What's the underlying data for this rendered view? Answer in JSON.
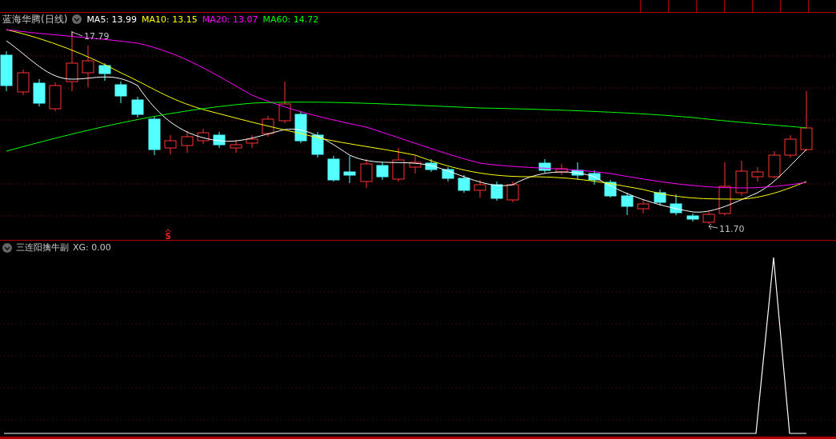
{
  "stock": {
    "name": "蓝海华腾",
    "period": "(日线)"
  },
  "moving_averages": [
    {
      "label": "MA5:",
      "value": "13.99",
      "color": "#ffffff"
    },
    {
      "label": "MA10:",
      "value": "13.15",
      "color": "#ffff00"
    },
    {
      "label": "MA20:",
      "value": "13.07",
      "color": "#ff00ff"
    },
    {
      "label": "MA60:",
      "value": "14.72",
      "color": "#00ff00"
    }
  ],
  "price_chart": {
    "high_marker": "17.79",
    "low_marker": "11.70",
    "signal_mark": "S"
  },
  "indicator": {
    "name": "三连阳擒牛副",
    "reading": "XG: 0.00"
  }
}
